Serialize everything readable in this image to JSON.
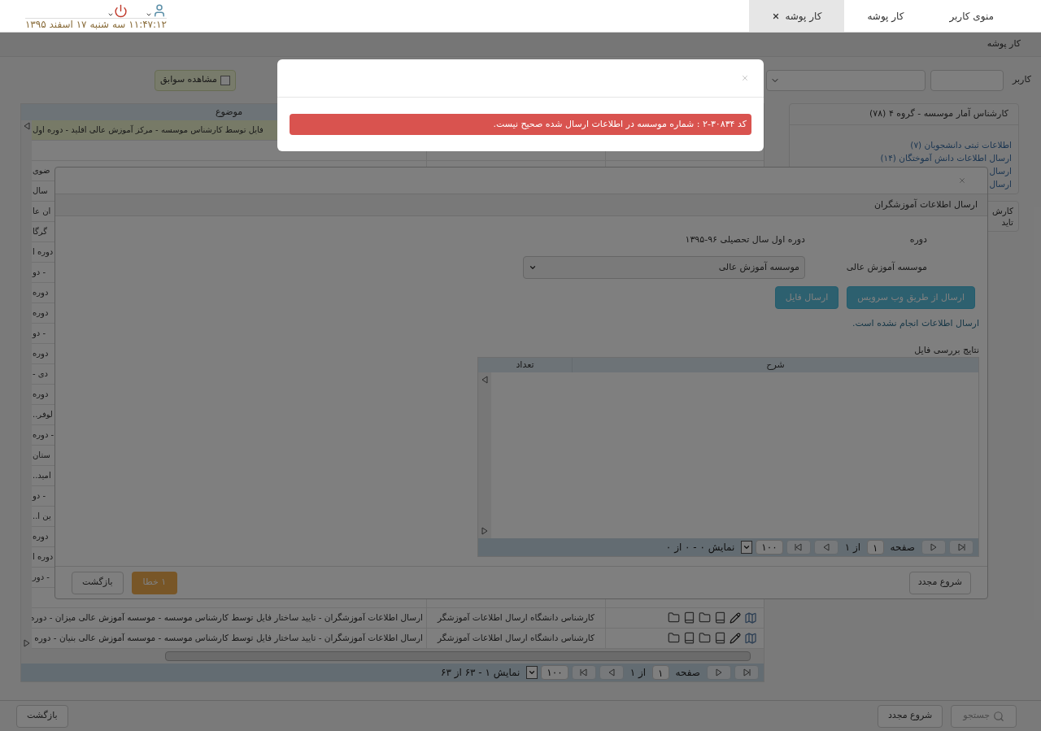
{
  "top_bar": {
    "tabs": [
      {
        "label": "منوی کاربر",
        "selected": false,
        "closable": false
      },
      {
        "label": "کار پوشه",
        "selected": false,
        "closable": false
      },
      {
        "label": "کار پوشه",
        "selected": true,
        "closable": true
      }
    ],
    "datetime": "۱۱:۴۷:۱۲ سه شنبه ۱۷ اسفند ۱۳۹۵"
  },
  "breadcrumb": "کار پوشه",
  "filters": {
    "user_label": "کاربر",
    "history_checkbox": {
      "label": "مشاهده سوابق",
      "checked": false
    }
  },
  "sidebar": {
    "panel": {
      "title": "کارشناس آمار موسسه - گروه ۴ (۷۸)",
      "links": [
        "اطلاعات ثبتی دانشجویان (۷)",
        "ارسال اطلاعات دانش آموختگان (۱۴)",
        "ارسال",
        "ارسال"
      ]
    },
    "panel_2": {
      "lines": [
        "کارش",
        "تاید"
      ]
    }
  },
  "table": {
    "columns": [
      "موضوع"
    ],
    "rows": [
      {
        "kind": "fragment",
        "selected": true,
        "subject": "فایل توسط کارشناس موسسه - مرکز آموزش عالی اقلید - دوره اول"
      },
      {
        "kind": "covered",
        "selected": false
      },
      {
        "kind": "fragment",
        "selected": false,
        "subject": "ضوی"
      },
      {
        "kind": "fragment",
        "selected": false,
        "subject": "سال"
      },
      {
        "kind": "fragment",
        "selected": false,
        "subject": "ان عا"
      },
      {
        "kind": "fragment",
        "selected": false,
        "subject": "گرگا"
      },
      {
        "kind": "fragment",
        "selected": false,
        "subject": "دوره ا"
      },
      {
        "kind": "fragment",
        "selected": false,
        "subject": "- دو"
      },
      {
        "kind": "fragment",
        "selected": false,
        "subject": "دوره"
      },
      {
        "kind": "fragment",
        "selected": false,
        "subject": "دوره"
      },
      {
        "kind": "fragment",
        "selected": false,
        "subject": "- دو"
      },
      {
        "kind": "fragment",
        "selected": false,
        "subject": "دوره"
      },
      {
        "kind": "fragment",
        "selected": false,
        "subject": "دی -"
      },
      {
        "kind": "fragment",
        "selected": false,
        "subject": "دوره"
      },
      {
        "kind": "fragment",
        "selected": false,
        "subject": "لوفر.."
      },
      {
        "kind": "fragment",
        "selected": false,
        "subject": "- دوره"
      },
      {
        "kind": "fragment",
        "selected": false,
        "subject": "ستان"
      },
      {
        "kind": "fragment",
        "selected": false,
        "subject": "امید.."
      },
      {
        "kind": "fragment",
        "selected": false,
        "subject": "- دو"
      },
      {
        "kind": "fragment",
        "selected": false,
        "subject": "ین ا.."
      },
      {
        "kind": "fragment",
        "selected": false,
        "subject": "دوره"
      },
      {
        "kind": "fragment",
        "selected": false,
        "subject": "دوره ا"
      },
      {
        "kind": "fragment",
        "selected": false,
        "subject": "- دور"
      },
      {
        "kind": "covered",
        "selected": false
      },
      {
        "kind": "full",
        "selected": false,
        "role": "کارشناس دانشگاه ارسال اطلاعات آموزشگر",
        "subject": "ارسال اطلاعات آموزشگران - تایید ساختار فایل توسط کارشناس موسسه - موسسه آموزش عالی میزان - دوره"
      },
      {
        "kind": "full",
        "selected": false,
        "role": "کارشناس دانشگاه ارسال اطلاعات آموزشگر",
        "subject": "ارسال اطلاعات آموزشگران - تایید ساختار فایل توسط کارشناس موسسه - موسسه آموزش عالی بنیان - دوره"
      }
    ],
    "pager": {
      "page_label": "صفحه",
      "page": "۱",
      "of": "از ۱",
      "page_size": "۱۰۰",
      "summary": "نمایش ۱ - ۶۳ از ۶۳"
    }
  },
  "bottom_bar": {
    "search": "جستجو",
    "reset": "شروع مجدد",
    "back": "بازگشت"
  },
  "dialog": {
    "title": "ارسال اطلاعات آموزشگران",
    "fields": [
      {
        "label": "دوره",
        "kind": "text",
        "value": "دوره اول سال تحصیلی ۹۶-۱۳۹۵"
      },
      {
        "label": "موسسه آموزش عالی",
        "kind": "select",
        "value": "موسسه آموزش عالی"
      }
    ],
    "buttons": [
      "ارسال از طریق وب سرویس",
      "ارسال فایل"
    ],
    "status": "ارسال اطلاعات انجام نشده است.",
    "results_title": "نتایج بررسی فایل",
    "grid": {
      "columns": [
        "شرح",
        "تعداد"
      ],
      "pager": {
        "page_label": "صفحه",
        "page": "۱",
        "of": "از ۱",
        "page_size": "۱۰۰",
        "summary": "نمایش ۰ - ۰ از ۰"
      }
    },
    "footer": {
      "reset": "شروع مجدد",
      "errors": "۱ خطا",
      "back": "بازگشت"
    }
  },
  "alert_dialog": {
    "message": "کد ۳۰۸۳۴-۲ : شماره موسسه در اطلاعات ارسال شده صحیح نیست."
  }
}
